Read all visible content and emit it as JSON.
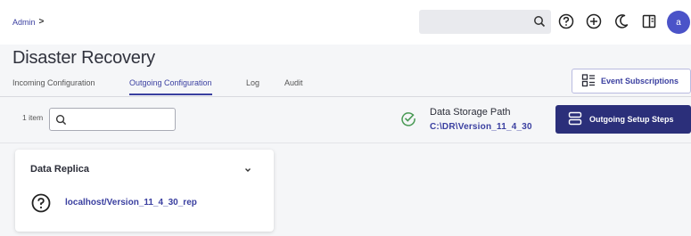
{
  "header": {
    "breadcrumb": {
      "label": "Admin",
      "separator": ">"
    },
    "avatar_initial": "a",
    "icons": [
      "search-icon",
      "help-icon",
      "add-icon",
      "moon-icon",
      "panel-icon"
    ]
  },
  "page": {
    "title": "Disaster Recovery"
  },
  "tabs": [
    {
      "label": "Incoming Configuration",
      "active": false
    },
    {
      "label": "Outgoing Configuration",
      "active": true
    },
    {
      "label": "Log",
      "active": false
    },
    {
      "label": "Audit",
      "active": false
    }
  ],
  "toolbar": {
    "event_subscriptions_label": "Event Subscriptions",
    "item_count": "1 item",
    "filter_placeholder": ""
  },
  "storage": {
    "label": "Data Storage Path",
    "path": "C:\\DR\\Version_11_4_30"
  },
  "setup": {
    "label": "Outgoing Setup Steps"
  },
  "card": {
    "title": "Data Replica",
    "link": "localhost/Version_11_4_30_rep"
  },
  "colors": {
    "accent": "#3a3fa0",
    "primary_button": "#2b2f7a",
    "avatar": "#4b53c8",
    "success": "#4a9a55"
  }
}
